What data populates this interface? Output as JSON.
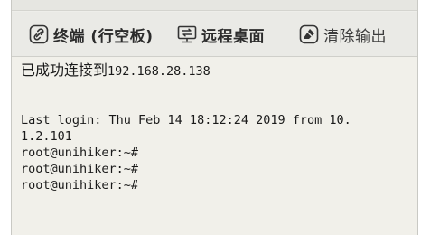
{
  "toolbar": {
    "tabs": [
      {
        "label": "终端 (行空板)",
        "icon": "link-icon"
      },
      {
        "label": "远程桌面",
        "icon": "monitor-icon"
      },
      {
        "label": "清除输出",
        "icon": "eraser-icon"
      }
    ]
  },
  "terminal": {
    "connected_prefix": "已成功连接到",
    "connected_ip": "192.168.28.138",
    "last_login_line1": "Last login: Thu Feb 14 18:12:24 2019 from 10.",
    "last_login_line2": "1.2.101",
    "prompts": [
      "root@unihiker:~#",
      "root@unihiker:~#",
      "root@unihiker:~#"
    ]
  }
}
